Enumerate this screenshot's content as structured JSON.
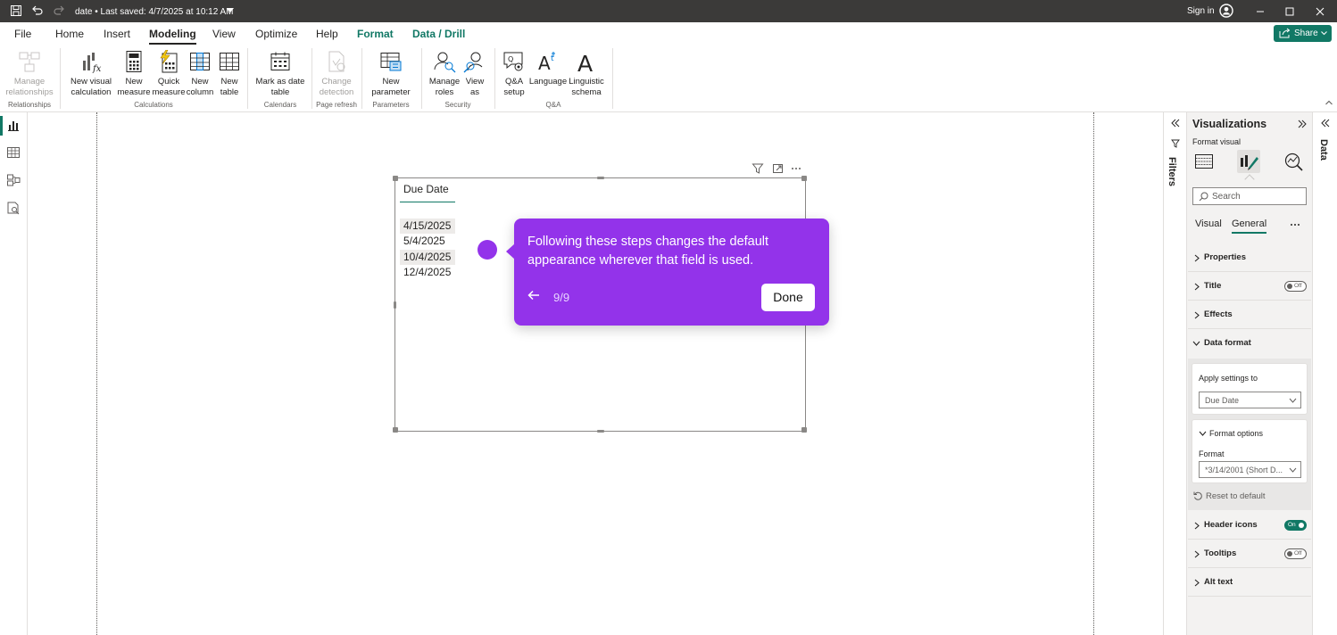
{
  "titlebar": {
    "document": "date • Last saved: 4/7/2025 at 10:12 AM",
    "sign_in": "Sign in",
    "icons": [
      "save-icon",
      "undo-icon",
      "redo-icon",
      "minimize-icon",
      "maximize-icon",
      "close-icon"
    ]
  },
  "menu": {
    "tabs": [
      "File",
      "Home",
      "Insert",
      "Modeling",
      "View",
      "Optimize",
      "Help",
      "Format",
      "Data / Drill"
    ],
    "active": "Modeling",
    "share": "Share"
  },
  "ribbon": {
    "buttons": [
      {
        "label": "Manage relationships",
        "enabled": false,
        "icon": "relationships-icon"
      },
      {
        "label": "New visual calculation",
        "enabled": true,
        "icon": "visual-calculation-icon"
      },
      {
        "label": "New measure",
        "enabled": true,
        "icon": "calculator-icon"
      },
      {
        "label": "Quick measure",
        "enabled": true,
        "icon": "quick-measure-icon"
      },
      {
        "label": "New column",
        "enabled": true,
        "icon": "new-column-icon"
      },
      {
        "label": "New table",
        "enabled": true,
        "icon": "new-table-icon"
      },
      {
        "label": "Mark as date table",
        "enabled": true,
        "icon": "calendar-icon"
      },
      {
        "label": "Change detection",
        "enabled": false,
        "icon": "change-detection-icon"
      },
      {
        "label": "New parameter",
        "enabled": true,
        "icon": "parameter-icon"
      },
      {
        "label": "Manage roles",
        "enabled": true,
        "icon": "manage-roles-icon"
      },
      {
        "label": "View as",
        "enabled": true,
        "icon": "view-as-icon"
      },
      {
        "label": "Q&A setup",
        "enabled": true,
        "icon": "qa-setup-icon"
      },
      {
        "label": "Language",
        "enabled": true,
        "icon": "language-icon"
      },
      {
        "label": "Linguistic schema",
        "enabled": true,
        "icon": "linguistic-schema-icon"
      }
    ],
    "groups": [
      "Relationships",
      "Calculations",
      "Calendars",
      "Page refresh",
      "Parameters",
      "Security",
      "Q&A"
    ]
  },
  "visual": {
    "header": "Due Date",
    "rows": [
      "4/15/2025",
      "5/4/2025",
      "10/4/2025",
      "12/4/2025"
    ],
    "highlighted_rows": [
      0,
      2
    ]
  },
  "tooltip": {
    "message": "Following these steps changes the default appearance wherever that field is used.",
    "step": "9/9",
    "done": "Done",
    "accent": "#9333ea"
  },
  "filters": {
    "label": "Filters"
  },
  "viz_pane": {
    "title": "Visualizations",
    "subtitle": "Format visual",
    "search_placeholder": "Search",
    "tabs": [
      "Visual",
      "General"
    ],
    "active_tab": "General",
    "sections": {
      "properties": "Properties",
      "title": "Title",
      "effects": "Effects",
      "data_format": "Data format",
      "header_icons": "Header icons",
      "tooltips": "Tooltips",
      "alt_text": "Alt text"
    },
    "toggles": {
      "title": "Off",
      "header_icons": "On",
      "tooltips": "Off"
    },
    "apply_settings_label": "Apply settings to",
    "apply_settings_value": "Due Date",
    "format_options_label": "Format options",
    "format_label": "Format",
    "format_value": "*3/14/2001 (Short D...",
    "reset": "Reset to default"
  },
  "data_pane": {
    "label": "Data"
  },
  "colors": {
    "brand": "#117865",
    "titlebar": "#3b3a39"
  }
}
